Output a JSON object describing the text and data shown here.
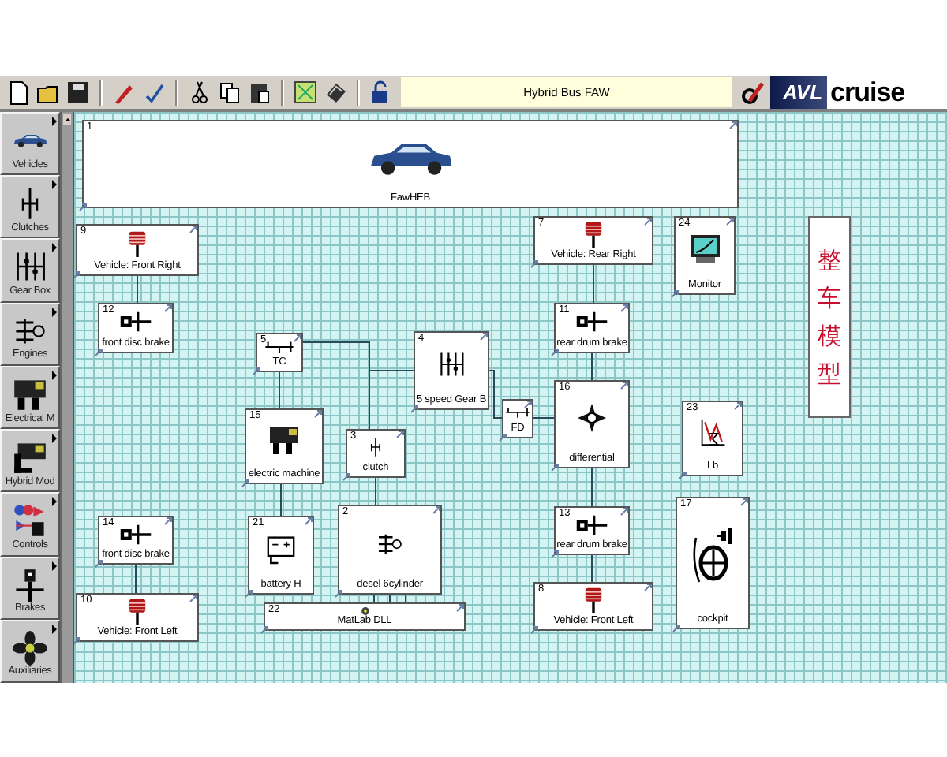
{
  "toolbar": {
    "title": "Hybrid Bus FAW",
    "logo": {
      "brand": "AVL",
      "product": "cruise"
    }
  },
  "sidebar": {
    "items": [
      {
        "label": "Vehicles",
        "kind": "car"
      },
      {
        "label": "Clutches",
        "kind": "clutch"
      },
      {
        "label": "Gear Box",
        "kind": "gearbox"
      },
      {
        "label": "Engines",
        "kind": "engine"
      },
      {
        "label": "Electrical M",
        "kind": "motor"
      },
      {
        "label": "Hybrid Mod",
        "kind": "hybrid"
      },
      {
        "label": "Controls",
        "kind": "controls"
      },
      {
        "label": "Brakes",
        "kind": "brakepedal"
      },
      {
        "label": "Auxiliaries",
        "kind": "fan"
      }
    ]
  },
  "diagram": {
    "components": [
      {
        "number": "1",
        "label": "FawHEB",
        "kind": "car"
      },
      {
        "number": "9",
        "label": "Vehicle: Front Right",
        "kind": "wheel"
      },
      {
        "number": "12",
        "label": "front disc brake",
        "kind": "brake"
      },
      {
        "number": "5",
        "label": "TC",
        "kind": "coupling"
      },
      {
        "number": "4",
        "label": "5 speed Gear B",
        "kind": "gearbox"
      },
      {
        "number": "7",
        "label": "Vehicle: Rear Right",
        "kind": "wheel"
      },
      {
        "number": "24",
        "label": "Monitor",
        "kind": "monitor"
      },
      {
        "number": "11",
        "label": "rear drum brake",
        "kind": "brake"
      },
      {
        "label": "FD",
        "kind": "coupling"
      },
      {
        "number": "16",
        "label": "differential",
        "kind": "differential"
      },
      {
        "number": "23",
        "label": "Lb",
        "kind": "lb"
      },
      {
        "number": "15",
        "label": "electric machine",
        "kind": "motor"
      },
      {
        "number": "3",
        "label": "clutch",
        "kind": "clutch"
      },
      {
        "number": "14",
        "label": "front disc brake",
        "kind": "brake"
      },
      {
        "number": "21",
        "label": "battery H",
        "kind": "battery"
      },
      {
        "number": "2",
        "label": "desel 6cylinder",
        "kind": "engine"
      },
      {
        "number": "10",
        "label": "Vehicle: Front Left",
        "kind": "wheel"
      },
      {
        "number": "22",
        "label": "MatLab DLL",
        "kind": "dll"
      },
      {
        "number": "13",
        "label": "rear drum brake",
        "kind": "brake"
      },
      {
        "number": "8",
        "label": "Vehicle: Front Left",
        "kind": "wheel"
      },
      {
        "number": "17",
        "label": "cockpit",
        "kind": "cockpit"
      }
    ],
    "note": "整车模型"
  }
}
